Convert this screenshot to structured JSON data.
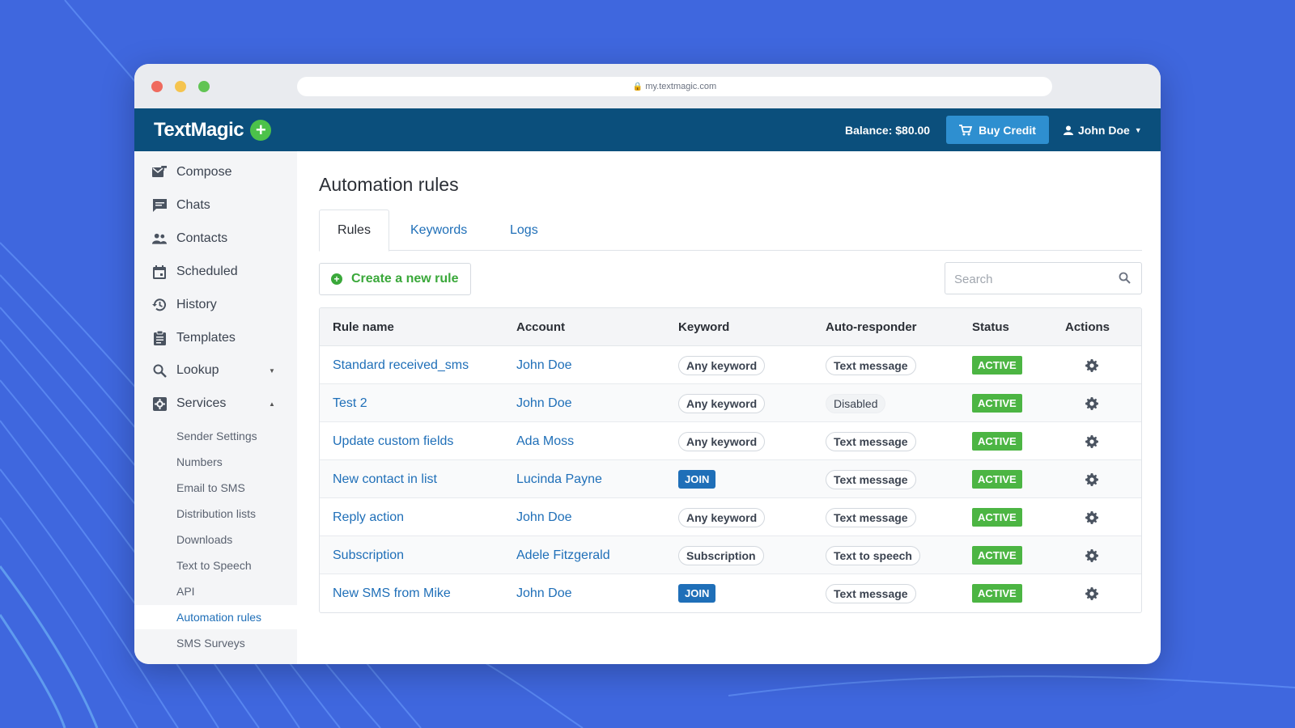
{
  "browser": {
    "url": "my.textmagic.com"
  },
  "header": {
    "logo": "TextMagic",
    "balance": "Balance: $80.00",
    "buy_credit": "Buy Credit",
    "user_name": "John Doe"
  },
  "sidebar": {
    "items": [
      {
        "label": "Compose",
        "icon": "compose-icon"
      },
      {
        "label": "Chats",
        "icon": "chat-icon"
      },
      {
        "label": "Contacts",
        "icon": "contacts-icon"
      },
      {
        "label": "Scheduled",
        "icon": "calendar-icon"
      },
      {
        "label": "History",
        "icon": "history-icon"
      },
      {
        "label": "Templates",
        "icon": "clipboard-icon"
      },
      {
        "label": "Lookup",
        "icon": "search-icon"
      },
      {
        "label": "Services",
        "icon": "services-icon"
      }
    ],
    "services_sub": [
      {
        "label": "Sender Settings"
      },
      {
        "label": "Numbers"
      },
      {
        "label": "Email to SMS"
      },
      {
        "label": "Distribution lists"
      },
      {
        "label": "Downloads"
      },
      {
        "label": "Text to Speech"
      },
      {
        "label": "API"
      },
      {
        "label": "Automation rules"
      },
      {
        "label": "SMS Surveys"
      }
    ],
    "active_sub": "Automation rules"
  },
  "main": {
    "title": "Automation rules",
    "tabs": [
      {
        "label": "Rules",
        "active": true
      },
      {
        "label": "Keywords",
        "active": false
      },
      {
        "label": "Logs",
        "active": false
      }
    ],
    "create_button": "Create a new rule",
    "search_placeholder": "Search"
  },
  "table": {
    "headers": [
      "Rule name",
      "Account",
      "Keyword",
      "Auto-responder",
      "Status",
      "Actions"
    ],
    "rows": [
      {
        "rule": "Standard received_sms",
        "account": "John Doe",
        "keyword": "Any keyword",
        "keyword_type": "pill",
        "auto": "Text message",
        "auto_type": "pill",
        "status": "ACTIVE"
      },
      {
        "rule": "Test 2",
        "account": "John Doe",
        "keyword": "Any keyword",
        "keyword_type": "pill",
        "auto": "Disabled",
        "auto_type": "muted",
        "status": "ACTIVE"
      },
      {
        "rule": "Update custom fields",
        "account": "Ada Moss",
        "keyword": "Any keyword",
        "keyword_type": "pill",
        "auto": "Text message",
        "auto_type": "pill",
        "status": "ACTIVE"
      },
      {
        "rule": "New contact in list",
        "account": "Lucinda Payne",
        "keyword": "JOIN",
        "keyword_type": "join",
        "auto": "Text message",
        "auto_type": "pill",
        "status": "ACTIVE"
      },
      {
        "rule": "Reply action",
        "account": "John Doe",
        "keyword": "Any keyword",
        "keyword_type": "pill",
        "auto": "Text message",
        "auto_type": "pill",
        "status": "ACTIVE"
      },
      {
        "rule": "Subscription",
        "account": "Adele Fitzgerald",
        "keyword": "Subscription",
        "keyword_type": "pill",
        "auto": "Text to speech",
        "auto_type": "pill",
        "status": "ACTIVE"
      },
      {
        "rule": "New SMS from Mike",
        "account": "John Doe",
        "keyword": "JOIN",
        "keyword_type": "join",
        "auto": "Text message",
        "auto_type": "pill",
        "status": "ACTIVE"
      }
    ]
  },
  "colors": {
    "background": "#3f67de",
    "topbar": "#0b4f7c",
    "accent_blue": "#1f6fb8",
    "active_green": "#4cb543"
  }
}
